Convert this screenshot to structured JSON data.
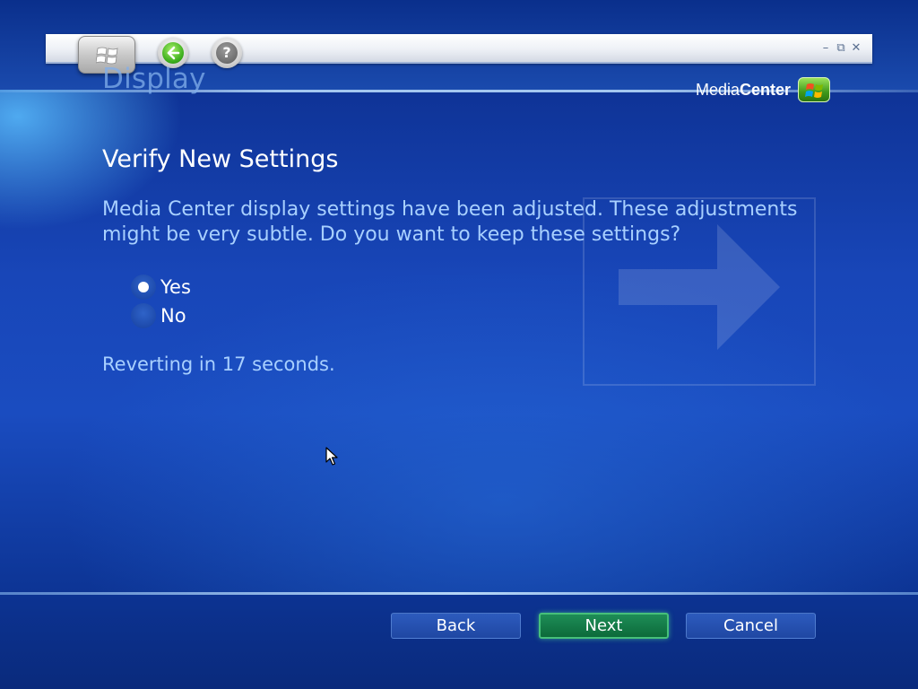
{
  "app": {
    "brand_light": "Media",
    "brand_bold": "Center",
    "page_title": "Display"
  },
  "toolbar": {
    "start_icon": "windows-logo-icon",
    "back_icon": "back-arrow-icon",
    "help_icon": "help-icon",
    "help_glyph": "?",
    "window_controls": {
      "minimize": "–",
      "restore": "⧉",
      "close": "✕"
    }
  },
  "main": {
    "heading": "Verify New Settings",
    "description": "Media Center display settings have been adjusted. These adjustments might be very subtle. Do you want to keep these settings?",
    "options": [
      {
        "label": "Yes",
        "selected": true
      },
      {
        "label": "No",
        "selected": false
      }
    ],
    "status": "Reverting in 17 seconds."
  },
  "buttons": {
    "back": "Back",
    "next": "Next",
    "cancel": "Cancel"
  },
  "colors": {
    "background": "#1a4cc0",
    "accent_text": "#a8d0ff",
    "focused_button": "#0c6a3a"
  }
}
